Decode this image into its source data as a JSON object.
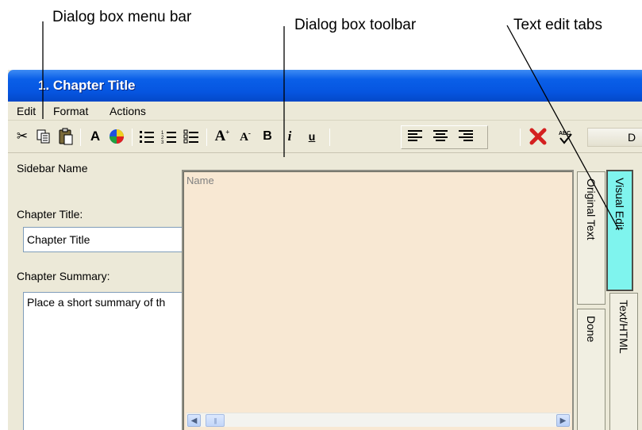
{
  "annotations": {
    "menu_bar": "Dialog box menu bar",
    "toolbar": "Dialog box toolbar",
    "edit_tabs": "Text edit tabs"
  },
  "window": {
    "title": "1. Chapter Title"
  },
  "menu": {
    "items": [
      "Edit",
      "Format",
      "Actions"
    ]
  },
  "toolbar": {
    "buttons": [
      {
        "name": "cut-icon",
        "glyph": "✂"
      },
      {
        "name": "copy-icon",
        "glyph": "⎘"
      },
      {
        "name": "paste-icon",
        "glyph": "📋"
      },
      {
        "name": "font-color-icon",
        "glyph": "A"
      },
      {
        "name": "color-picker-icon",
        "glyph": ""
      },
      {
        "name": "bullet-list-icon",
        "glyph": "☰"
      },
      {
        "name": "numbered-list-icon",
        "glyph": "☷"
      },
      {
        "name": "checklist-icon",
        "glyph": "☳"
      },
      {
        "name": "increase-font-icon",
        "glyph": "A"
      },
      {
        "name": "decrease-font-icon",
        "glyph": "A"
      },
      {
        "name": "bold-icon",
        "glyph": "B"
      },
      {
        "name": "italic-icon",
        "glyph": "i"
      },
      {
        "name": "underline-icon",
        "glyph": "u"
      },
      {
        "name": "align-left-icon",
        "glyph": "☰"
      },
      {
        "name": "align-center-icon",
        "glyph": "☰"
      },
      {
        "name": "align-right-icon",
        "glyph": "☰"
      },
      {
        "name": "delete-icon",
        "glyph": "✖"
      },
      {
        "name": "spellcheck-icon",
        "glyph": "ABC"
      }
    ],
    "trailing_text": "D"
  },
  "form": {
    "sidebar_name_label": "Sidebar Name",
    "chapter_title_label": "Chapter Title:",
    "chapter_title_value": "Chapter Title",
    "chapter_summary_label": "Chapter Summary:",
    "chapter_summary_value": "Place a short summary of th"
  },
  "editor": {
    "placeholder": "Name"
  },
  "tabs": {
    "original_text": "Original Text",
    "done": "Done",
    "visual_edit": "Visual Edit",
    "text_html": "Text/HTML"
  },
  "colors": {
    "title_bar": "#0655e0",
    "editor_bg": "#f8e8d3",
    "active_tab": "#7ff4ee",
    "delete_red": "#d42020"
  }
}
